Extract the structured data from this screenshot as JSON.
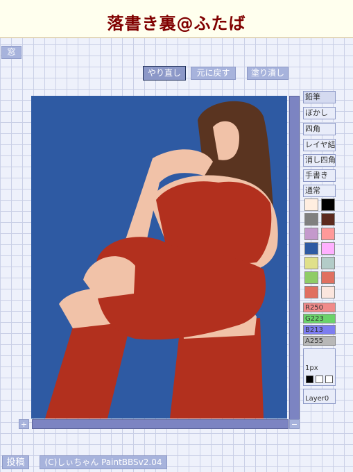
{
  "header": {
    "title": "落書き裏@ふたば"
  },
  "window_button": "窓",
  "toolbar": {
    "redo": "やり直し",
    "undo": "元に戻す",
    "fill": "塗り潰し"
  },
  "zoom": {
    "in": "+",
    "out": "−"
  },
  "tools": [
    "鉛筆",
    "ぼかし",
    "四角",
    "レイヤ結合",
    "消し四角",
    "手書き",
    "通常"
  ],
  "palette": [
    [
      "#ffeee0",
      "#000000"
    ],
    [
      "#808080",
      "#5c2a1e"
    ],
    [
      "#c499cc",
      "#ff9999"
    ],
    [
      "#2e5aa3",
      "#ffb0ff"
    ],
    [
      "#e0e08a",
      "#b3ccc8"
    ],
    [
      "#8fcc66",
      "#e07060"
    ],
    [
      "#e07060",
      "#fbe6de"
    ]
  ],
  "color_values": {
    "r": "R250",
    "g": "G223",
    "b": "B213",
    "a": "A255"
  },
  "pen_size": "1px",
  "layer": "Layer0",
  "footer": {
    "post": "投稿",
    "credit": "(C)しぃちゃん PaintBBSv2.04"
  },
  "colors": {
    "title": "#800000",
    "canvas_bg": "#2e5aa3",
    "button": "#a7b3dc"
  }
}
